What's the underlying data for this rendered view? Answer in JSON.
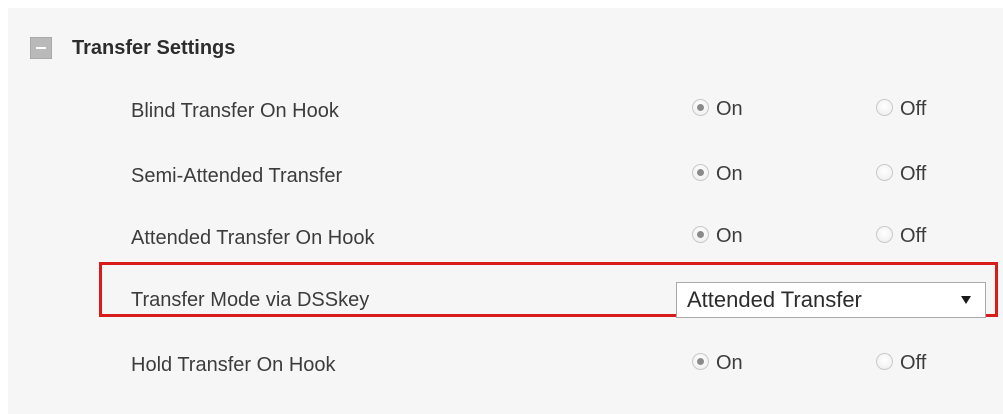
{
  "section": {
    "title": "Transfer Settings",
    "collapse_icon": "minus-square-icon"
  },
  "rows": [
    {
      "label": "Blind Transfer On Hook",
      "on_label": "On",
      "off_label": "Off",
      "selected": "On"
    },
    {
      "label": "Semi-Attended Transfer",
      "on_label": "On",
      "off_label": "Off",
      "selected": "On"
    },
    {
      "label": "Attended Transfer On Hook",
      "on_label": "On",
      "off_label": "Off",
      "selected": "On"
    },
    {
      "label": "Transfer Mode via DSSkey",
      "select_value": "Attended Transfer"
    },
    {
      "label": "Hold Transfer On Hook",
      "on_label": "On",
      "off_label": "Off",
      "selected": "On"
    }
  ],
  "colors": {
    "highlight": "#d81b1b",
    "panel_bg": "#f6f6f6"
  }
}
